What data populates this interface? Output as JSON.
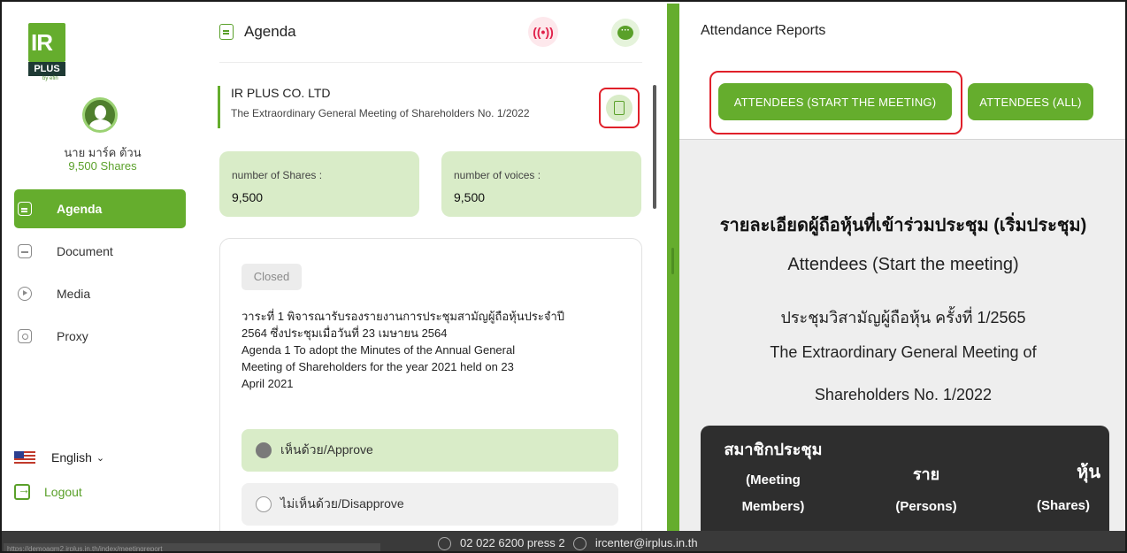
{
  "app": {
    "logo_text": "IR",
    "logo_plus": "PLUS",
    "logo_by": "by efin"
  },
  "user": {
    "name": "นาย มาร์ค ต้วน",
    "shares": "9,500 Shares"
  },
  "sidebar": {
    "items": [
      {
        "label": "Agenda",
        "icon": "agenda-icon",
        "active": true
      },
      {
        "label": "Document",
        "icon": "document-icon",
        "active": false
      },
      {
        "label": "Media",
        "icon": "media-icon",
        "active": false
      },
      {
        "label": "Proxy",
        "icon": "proxy-icon",
        "active": false
      }
    ],
    "language": "English",
    "logout": "Logout"
  },
  "agenda": {
    "header": "Agenda",
    "live_label": "LIVE",
    "company": "IR PLUS CO. LTD",
    "meeting": "The Extraordinary General Meeting of Shareholders No. 1/2022",
    "stats": [
      {
        "label": "number of Shares :",
        "value": "9,500"
      },
      {
        "label": "number of voices :",
        "value": "9,500"
      }
    ],
    "card": {
      "status": "Closed",
      "lines": [
        "วาระที่ 1 พิจารณารับรองรายงานการประชุมสามัญผู้ถือหุ้นประจำปี",
        "2564 ซึ่งประชุมเมื่อวันที่ 23 เมษายน 2564",
        "Agenda 1 To adopt the Minutes of the Annual General",
        "Meeting of Shareholders for the year 2021 held on 23",
        "April 2021"
      ],
      "approve": "เห็นด้วย/Approve",
      "disapprove": "ไม่เห็นด้วย/Disapprove"
    }
  },
  "report": {
    "title": "Attendance Reports",
    "btn_start": "ATTENDEES (START THE MEETING)",
    "btn_all": "ATTENDEES (ALL)",
    "heading_th": "รายละเอียดผู้ถือหุ้นที่เข้าร่วมประชุม (เริ่มประชุม)",
    "heading_en": "Attendees (Start the meeting)",
    "meeting_th": "ประชุมวิสามัญผู้ถือหุ้น ครั้งที่ 1/2565",
    "meeting_en_1": "The Extraordinary General Meeting of",
    "meeting_en_2": "Shareholders No. 1/2022",
    "table": {
      "col1_th": "สมาชิกประชุม",
      "col1_en_1": "(Meeting",
      "col1_en_2": "Members)",
      "col2_th": "ราย",
      "col2_en": "(Persons)",
      "col3_th": "หุ้น",
      "col3_en": "(Shares)"
    }
  },
  "footer": {
    "url": "https://demoagm2.irplus.in.th/index/meetingreport",
    "phone": "02 022 6200 press 2",
    "email": "ircenter@irplus.in.th"
  },
  "colors": {
    "brand_green": "#65ad2d",
    "light_green": "#d9ecc8",
    "highlight_red": "#e0202a",
    "live_red": "#e0204a"
  }
}
